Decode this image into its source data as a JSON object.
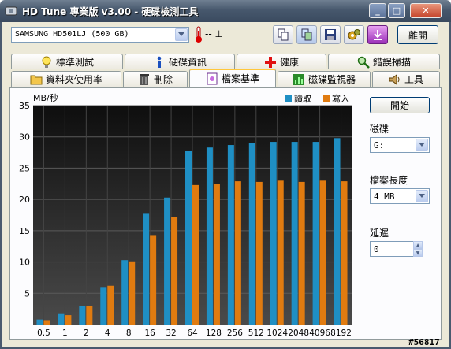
{
  "window": {
    "title": "HD Tune 專業版 v3.00 - 硬碟檢測工具",
    "minimize_label": "_",
    "maximize_label": "□",
    "close_label": "✕"
  },
  "toolbar": {
    "drive": "SAMSUNG HD501LJ (500 GB)",
    "temperature": "-- ⊥",
    "exit_label": "離開"
  },
  "tabs_top": [
    {
      "label": "標準測試",
      "icon": "bulb-icon"
    },
    {
      "label": "硬碟資訊",
      "icon": "info-icon"
    },
    {
      "label": "健康",
      "icon": "health-cross-icon"
    },
    {
      "label": "錯誤掃描",
      "icon": "magnifier-icon"
    }
  ],
  "tabs_bottom": [
    {
      "label": "資料夾使用率",
      "icon": "folder-icon"
    },
    {
      "label": "刪除",
      "icon": "trash-icon"
    },
    {
      "label": "檔案基準",
      "icon": "file-benchmark-icon",
      "active": true
    },
    {
      "label": "磁碟監視器",
      "icon": "monitor-chart-icon"
    },
    {
      "label": "工具",
      "icon": "speaker-icon"
    }
  ],
  "controls": {
    "start_label": "開始",
    "disk_label": "磁碟",
    "disk_value": "G:",
    "file_length_label": "檔案長度",
    "file_length_value": "4 MB",
    "delay_label": "延遲",
    "delay_value": "0"
  },
  "watermark": "#56817",
  "colors": {
    "read": "#1f8fc4",
    "write": "#e07b10",
    "plot_bg_top": "#0e0e0e",
    "plot_bg_bottom": "#4a4a4a"
  },
  "chart_data": {
    "type": "bar",
    "ylabel": "MB/秒",
    "ylim": [
      0,
      35
    ],
    "yticks": [
      5,
      10,
      15,
      20,
      25,
      30,
      35
    ],
    "categories": [
      "0.5",
      "1",
      "2",
      "4",
      "8",
      "16",
      "32",
      "64",
      "128",
      "256",
      "512",
      "1024",
      "2048",
      "4096",
      "8192"
    ],
    "series": [
      {
        "name": "讀取",
        "values": [
          0.8,
          1.8,
          3.0,
          6.0,
          10.3,
          17.7,
          20.3,
          27.7,
          28.3,
          28.7,
          29.0,
          29.2,
          29.2,
          29.2,
          29.8
        ]
      },
      {
        "name": "寫入",
        "values": [
          0.7,
          1.5,
          3.0,
          6.2,
          10.1,
          14.3,
          17.2,
          22.3,
          22.5,
          22.9,
          22.8,
          23.0,
          22.8,
          23.0,
          22.9
        ]
      }
    ],
    "grid": true,
    "legend": "top-right"
  }
}
